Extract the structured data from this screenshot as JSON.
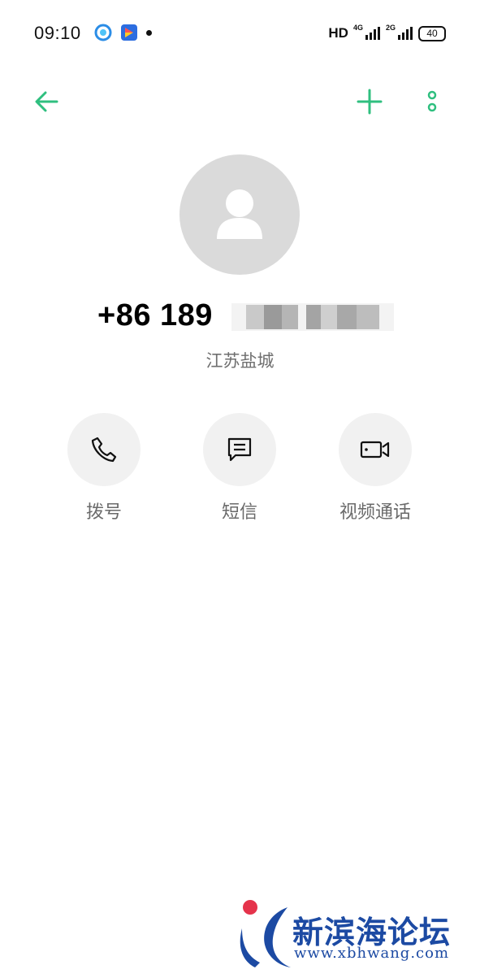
{
  "status_bar": {
    "time": "09:10",
    "app_icons": [
      "browser-app-icon",
      "maps-app-icon"
    ],
    "hd_label": "HD",
    "network_1": "4G",
    "network_2": "2G",
    "battery": "40"
  },
  "toolbar": {
    "back_icon": "arrow-left-icon",
    "add_icon": "plus-icon",
    "more_icon": "vertical-dots-icon",
    "accent_color": "#2fbf7f"
  },
  "contact": {
    "avatar_icon": "person-icon",
    "number": "+86 189",
    "location": "江苏盐城"
  },
  "actions": [
    {
      "label": "拨号",
      "icon": "phone-icon"
    },
    {
      "label": "短信",
      "icon": "message-icon"
    },
    {
      "label": "视频通话",
      "icon": "video-camera-icon"
    }
  ],
  "watermark": {
    "name": "新滨海论坛",
    "url": "www.xbhwang.com"
  }
}
